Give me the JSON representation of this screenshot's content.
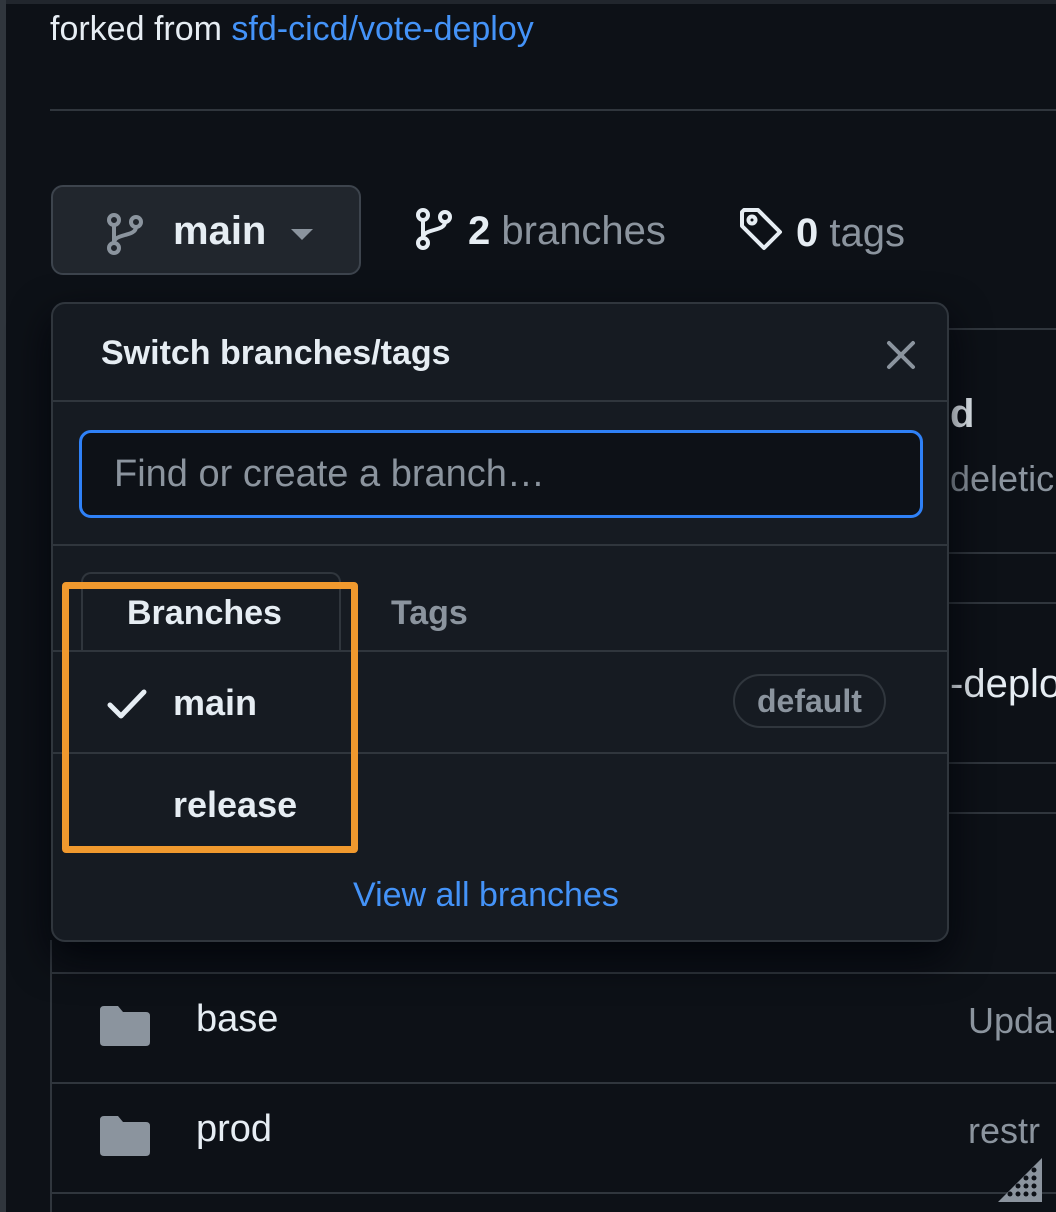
{
  "repo": {
    "forked_prefix": "forked from",
    "forked_link": "sfd-cicd/vote-deploy"
  },
  "branch_button": {
    "current": "main",
    "icon": "git-branch-icon",
    "caret_icon": "triangle-down-icon"
  },
  "counts": {
    "branches_num": "2",
    "branches_label": "branches",
    "tags_num": "0",
    "tags_label": "tags"
  },
  "dropdown": {
    "title": "Switch branches/tags",
    "search_placeholder": "Find or create a branch…",
    "tabs": [
      "Branches",
      "Tags"
    ],
    "active_tab": "Branches",
    "items": [
      {
        "name": "main",
        "selected": true,
        "badge": "default"
      },
      {
        "name": "release",
        "selected": false
      }
    ],
    "view_all": "View all branches"
  },
  "background_fragments": [
    "d",
    "deletic",
    "-deplo"
  ],
  "files": [
    {
      "name": "base",
      "message": "Upda"
    },
    {
      "name": "prod",
      "message": "restr"
    }
  ],
  "colors": {
    "background": "#0d1117",
    "accent": "#4493f8",
    "focus_border": "#2f81f7",
    "highlight": "#f0992e"
  }
}
